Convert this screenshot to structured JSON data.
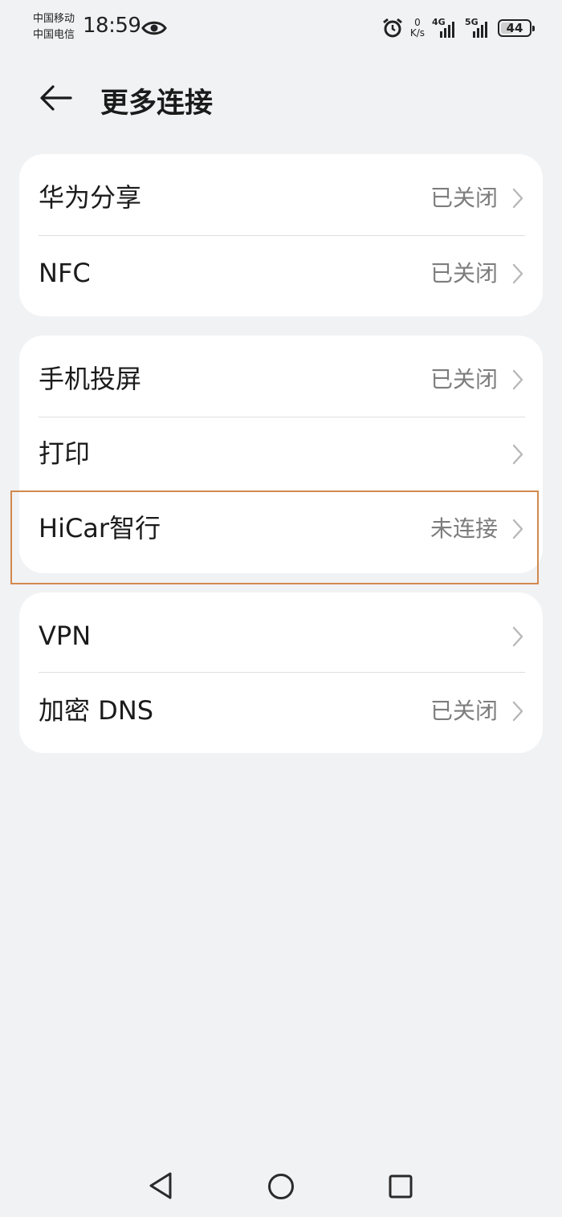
{
  "status_bar": {
    "carrier1": "中国移动",
    "carrier2": "中国电信",
    "time": "18:59",
    "net_speed_value": "0",
    "net_speed_unit": "K/s",
    "signal1_tag": "4G",
    "signal2_tag": "5G",
    "battery": "44"
  },
  "header": {
    "title": "更多连接"
  },
  "groups": [
    {
      "items": [
        {
          "label": "华为分享",
          "value": "已关闭"
        },
        {
          "label": "NFC",
          "value": "已关闭"
        }
      ]
    },
    {
      "items": [
        {
          "label": "手机投屏",
          "value": "已关闭"
        },
        {
          "label": "打印",
          "value": ""
        },
        {
          "label": "HiCar智行",
          "value": "未连接"
        }
      ]
    },
    {
      "items": [
        {
          "label": "VPN",
          "value": ""
        },
        {
          "label": "加密 DNS",
          "value": "已关闭"
        }
      ]
    }
  ],
  "colors": {
    "background": "#f1f2f4",
    "card": "#ffffff",
    "secondary_text": "#7d7d7d",
    "highlight": "#d2894e"
  },
  "icons": {
    "back": "arrow-left-icon",
    "chevron": "chevron-right-icon",
    "nav_back": "triangle-back-icon",
    "nav_home": "circle-home-icon",
    "nav_recent": "square-recents-icon"
  }
}
